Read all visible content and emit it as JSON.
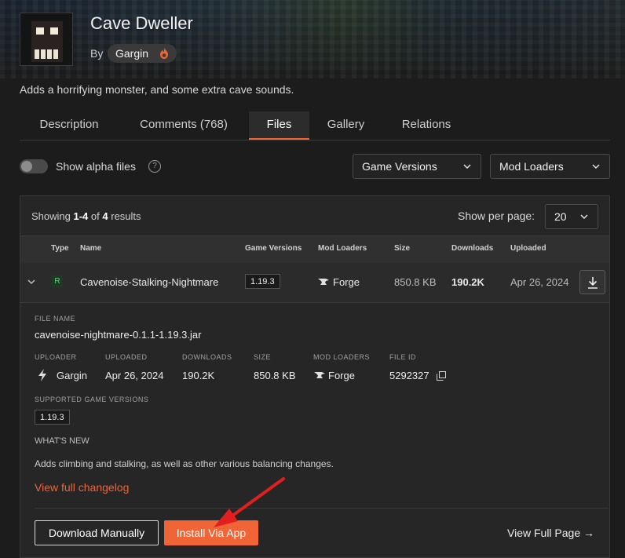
{
  "project": {
    "title": "Cave Dweller",
    "by_label": "By",
    "author": "Gargin",
    "summary": "Adds a horrifying monster, and some extra cave sounds."
  },
  "tabs": [
    {
      "label": "Description"
    },
    {
      "label": "Comments (768)"
    },
    {
      "label": "Files",
      "active": true
    },
    {
      "label": "Gallery"
    },
    {
      "label": "Relations"
    }
  ],
  "filters": {
    "show_alpha_label": "Show alpha files",
    "show_alpha_on": false,
    "game_versions": "Game Versions",
    "mod_loaders": "Mod Loaders"
  },
  "results": {
    "showing_prefix": "Showing",
    "range": "1-4",
    "of": "of",
    "total": "4",
    "suffix": "results",
    "per_page_label": "Show per page:",
    "per_page_value": "20"
  },
  "table": {
    "headers": [
      "Type",
      "Name",
      "Game Versions",
      "Mod Loaders",
      "Size",
      "Downloads",
      "Uploaded"
    ],
    "row": {
      "type_badge": "R",
      "name": "Cavenoise-Stalking-Nightmare",
      "game_version": "1.19.3",
      "mod_loader": "Forge",
      "size": "850.8 KB",
      "downloads": "190.2K",
      "uploaded": "Apr 26, 2024"
    }
  },
  "details": {
    "file_name_label": "FILE NAME",
    "file_name": "cavenoise-nightmare-0.1.1-1.19.3.jar",
    "uploader_label": "UPLOADER",
    "uploader": "Gargin",
    "uploaded_label": "UPLOADED",
    "uploaded": "Apr 26, 2024",
    "downloads_label": "DOWNLOADS",
    "downloads": "190.2K",
    "size_label": "SIZE",
    "size": "850.8 KB",
    "mod_loaders_label": "MOD LOADERS",
    "mod_loader": "Forge",
    "file_id_label": "FILE ID",
    "file_id": "5292327",
    "supported_label": "SUPPORTED GAME VERSIONS",
    "supported_version": "1.19.3",
    "whats_new_label": "WHAT'S NEW",
    "whats_new": "Adds climbing and stalking, as well as other various balancing changes.",
    "changelog_link": "View full changelog"
  },
  "actions": {
    "download_manually": "Download Manually",
    "install_via_app": "Install Via App",
    "view_full_page": "View Full Page →"
  },
  "colors": {
    "accent": "#f16436",
    "background": "#1c1c1c",
    "panel": "#262626",
    "release_badge": "#5fd07a"
  },
  "icons": [
    "flame-icon",
    "help-icon",
    "chevron-down-icon",
    "anvil-icon",
    "download-icon",
    "copy-icon",
    "lightning-icon",
    "arrow-right-icon",
    "annotation-arrow"
  ]
}
